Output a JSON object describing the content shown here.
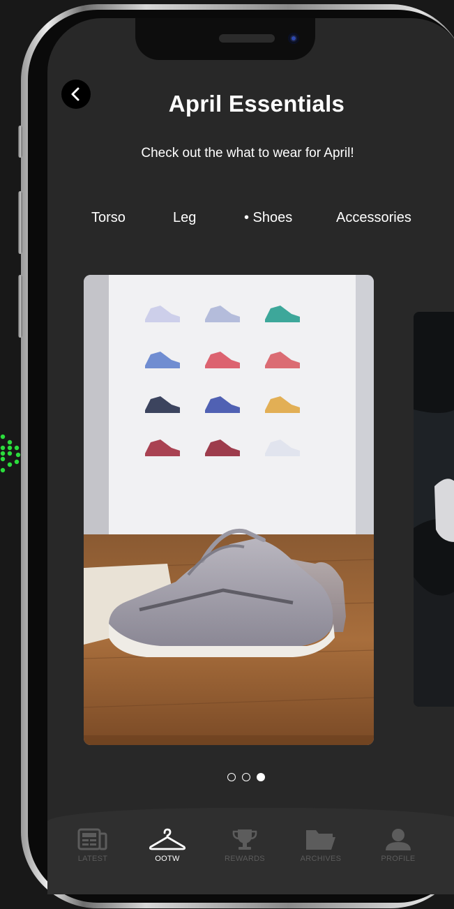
{
  "header": {
    "title": "April Essentials",
    "subtitle": "Check out the what to wear for April!"
  },
  "tabs": [
    {
      "label": "Torso",
      "active": false
    },
    {
      "label": "Leg",
      "active": false
    },
    {
      "label": "• Shoes",
      "active": true
    },
    {
      "label": "Accessories",
      "active": false
    }
  ],
  "carousel": {
    "slide_count": 3,
    "active_index": 2
  },
  "bottom_nav": [
    {
      "label": "LATEST",
      "icon": "newspaper-icon",
      "active": false
    },
    {
      "label": "OOTW",
      "icon": "hanger-icon",
      "active": true
    },
    {
      "label": "REWARDS",
      "icon": "trophy-icon",
      "active": false
    },
    {
      "label": "ARCHIVES",
      "icon": "folder-icon",
      "active": false
    },
    {
      "label": "PROFILE",
      "icon": "person-icon",
      "active": false
    }
  ],
  "colors": {
    "screen_bg": "#282828",
    "text_primary": "#ffffff",
    "nav_inactive": "#5c5c5c",
    "status_dots": "#2bdd3c"
  }
}
